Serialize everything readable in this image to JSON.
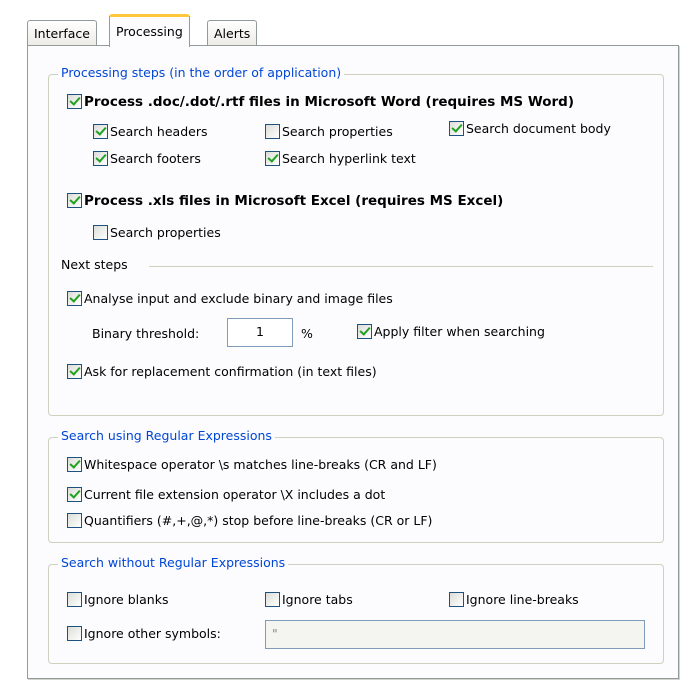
{
  "tabs": [
    {
      "label": "Interface"
    },
    {
      "label": "Processing"
    },
    {
      "label": "Alerts"
    }
  ],
  "processing_steps": {
    "legend": "Processing steps (in the order of application)",
    "word": {
      "label": "Process .doc/.dot/.rtf files in Microsoft Word (requires MS Word)",
      "checked": true,
      "options": {
        "search_headers": {
          "label": "Search headers",
          "checked": true
        },
        "search_properties": {
          "label": "Search properties",
          "checked": false
        },
        "search_document_body": {
          "label": "Search document body",
          "checked": true
        },
        "search_footers": {
          "label": "Search footers",
          "checked": true
        },
        "search_hyperlink_text": {
          "label": "Search hyperlink text",
          "checked": true
        }
      }
    },
    "excel": {
      "label": "Process .xls files in Microsoft Excel (requires MS Excel)",
      "checked": true,
      "search_properties": {
        "label": "Search properties",
        "checked": false
      }
    },
    "next_steps": {
      "title": "Next steps",
      "analyse": {
        "label": "Analyse input and exclude binary and image files",
        "checked": true
      },
      "binary_threshold_label": "Binary threshold:",
      "binary_threshold_value": "1",
      "percent_sign": "%",
      "apply_filter": {
        "label": "Apply filter when searching",
        "checked": true
      },
      "ask_confirmation": {
        "label": "Ask for replacement confirmation (in text files)",
        "checked": true
      }
    }
  },
  "regex": {
    "legend": "Search using Regular Expressions",
    "whitespace": {
      "label": "Whitespace operator \\s matches line-breaks (CR and LF)",
      "checked": true
    },
    "extension": {
      "label": "Current file extension operator \\X includes a dot",
      "checked": true
    },
    "quantifiers": {
      "label": "Quantifiers (#,+,@,*) stop before line-breaks (CR or LF)",
      "checked": false
    }
  },
  "no_regex": {
    "legend": "Search without Regular Expressions",
    "ignore_blanks": {
      "label": "Ignore blanks",
      "checked": false
    },
    "ignore_tabs": {
      "label": "Ignore tabs",
      "checked": false
    },
    "ignore_line_breaks": {
      "label": "Ignore line-breaks",
      "checked": false
    },
    "ignore_other_symbols": {
      "label": "Ignore other symbols:",
      "checked": false
    },
    "other_symbols_value": "\""
  },
  "colors": {
    "legend_text": "#0046d5",
    "check_mark": "#21a121",
    "checkbox_border": "#1c5180",
    "active_tab_accent": "#ffc83c"
  }
}
